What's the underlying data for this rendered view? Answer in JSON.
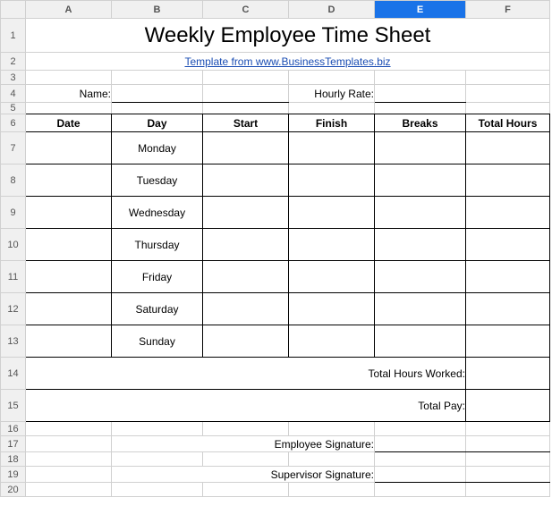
{
  "columns": [
    "A",
    "B",
    "C",
    "D",
    "E",
    "F"
  ],
  "rows": [
    "1",
    "2",
    "3",
    "4",
    "5",
    "6",
    "7",
    "8",
    "9",
    "10",
    "11",
    "12",
    "13",
    "14",
    "15",
    "16",
    "17",
    "18",
    "19",
    "20"
  ],
  "selected_column": "E",
  "title": "Weekly Employee Time Sheet",
  "subtitle": "Template from www.BusinessTemplates.biz",
  "name_label": "Name:",
  "rate_label": "Hourly Rate:",
  "table_headers": {
    "date": "Date",
    "day": "Day",
    "start": "Start",
    "finish": "Finish",
    "breaks": "Breaks",
    "total": "Total Hours"
  },
  "days": [
    "Monday",
    "Tuesday",
    "Wednesday",
    "Thursday",
    "Friday",
    "Saturday",
    "Sunday"
  ],
  "totals": {
    "hours_label": "Total Hours Worked:",
    "pay_label": "Total Pay:"
  },
  "signatures": {
    "employee": "Employee Signature:",
    "supervisor": "Supervisor Signature:"
  }
}
